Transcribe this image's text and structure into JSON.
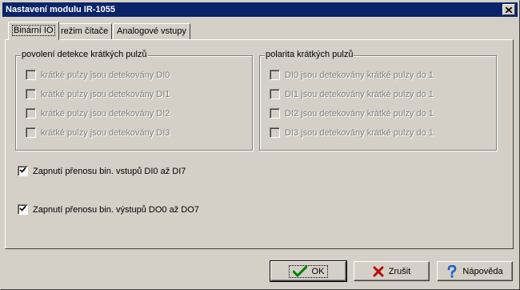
{
  "window": {
    "title": "Nastavení modulu IR-1055"
  },
  "tabs": [
    {
      "label": "Binární IO",
      "active": true
    },
    {
      "label": "režim čítače",
      "active": false
    },
    {
      "label": "Analogové vstupy",
      "active": false
    }
  ],
  "group_detect": {
    "title": "povolení detekce krátkých pulzů",
    "items": [
      {
        "label": "krátké pulzy jsou detekovány DI0",
        "checked": false,
        "enabled": false
      },
      {
        "label": "krátké pulzy jsou detekovány DI1",
        "checked": false,
        "enabled": false
      },
      {
        "label": "krátké pulzy jsou detekovány DI2",
        "checked": false,
        "enabled": false
      },
      {
        "label": "krátké pulzy jsou detekovány DI3",
        "checked": false,
        "enabled": false
      }
    ]
  },
  "group_polarity": {
    "title": "polarita krátkých pulzů",
    "items": [
      {
        "label": "DI0 jsou detekovány krátké pulzy do 1",
        "checked": false,
        "enabled": false
      },
      {
        "label": "DI1 jsou detekovány krátké pulzy do 1",
        "checked": false,
        "enabled": false
      },
      {
        "label": "DI2 jsou detekovány krátké pulzy do 1",
        "checked": false,
        "enabled": false
      },
      {
        "label": "DI3 jsou detekovány krátké pulzy do 1",
        "checked": false,
        "enabled": false
      }
    ]
  },
  "transfer_inputs": {
    "label": "Zapnutí přenosu bin. vstupů DI0 až DI7",
    "checked": true
  },
  "transfer_outputs": {
    "label": "Zapnutí přenosu bin. výstupů DO0 až DO7",
    "checked": true
  },
  "buttons": {
    "ok": {
      "label": "OK",
      "icon": "checkmark-icon"
    },
    "cancel": {
      "label": "Zrušit",
      "icon": "cross-icon"
    },
    "help": {
      "label": "Nápověda",
      "icon": "help-icon"
    }
  },
  "colors": {
    "titlebar": "#0a246a",
    "face": "#d4d0c8",
    "ok_check": "#008000",
    "cancel_x": "#c00000",
    "help": "#1f5fc8"
  }
}
